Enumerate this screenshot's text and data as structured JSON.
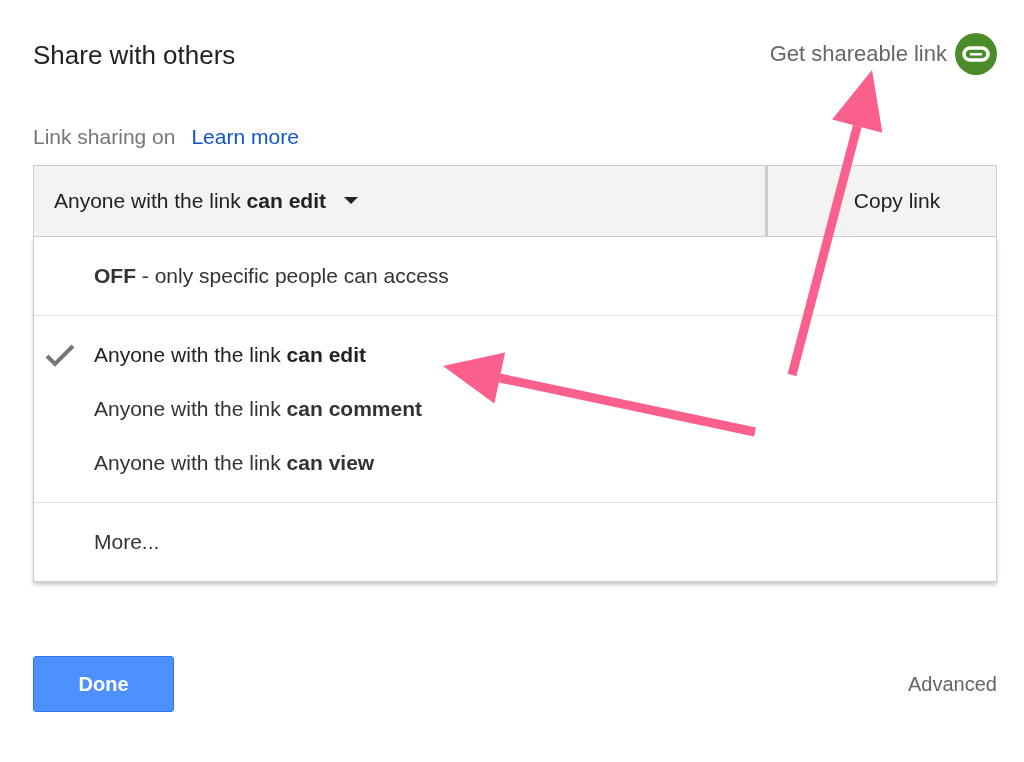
{
  "dialog": {
    "title": "Share with others",
    "shareable_link": "Get shareable link"
  },
  "link_sharing": {
    "label": "Link sharing on",
    "learn_more": "Learn more"
  },
  "access_dropdown": {
    "value": "Anyone with the link **can edit**"
  },
  "copy_button": "Copy link",
  "menu_sections": [
    [
      {
        "text": "**OFF** - only specific people can access",
        "selected": false
      }
    ],
    [
      {
        "text": "Anyone with the link **can edit**",
        "selected": true
      },
      {
        "text": "Anyone with the link **can comment**",
        "selected": false
      },
      {
        "text": "Anyone with the link **can view**",
        "selected": false
      }
    ],
    [
      {
        "text": "More...",
        "selected": false
      }
    ]
  ],
  "footer": {
    "done": "Done",
    "advanced": "Advanced"
  },
  "annotations": [
    {
      "kind": "arrow"
    },
    {
      "kind": "arrow"
    }
  ]
}
